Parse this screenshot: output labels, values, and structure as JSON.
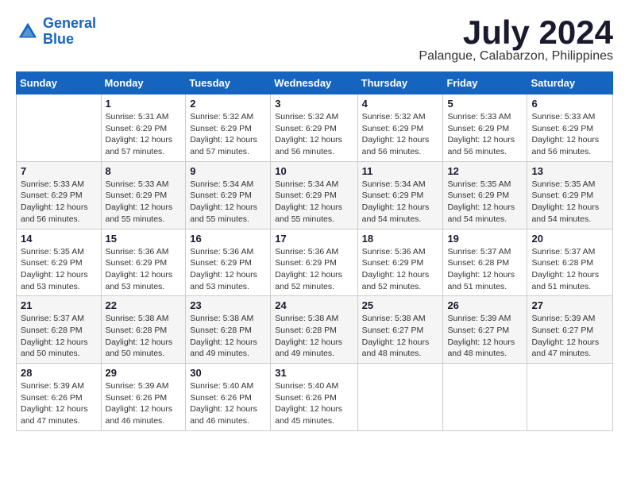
{
  "header": {
    "logo_line1": "General",
    "logo_line2": "Blue",
    "month_year": "July 2024",
    "location": "Palangue, Calabarzon, Philippines"
  },
  "weekdays": [
    "Sunday",
    "Monday",
    "Tuesday",
    "Wednesday",
    "Thursday",
    "Friday",
    "Saturday"
  ],
  "weeks": [
    [
      {
        "day": "",
        "info": ""
      },
      {
        "day": "1",
        "info": "Sunrise: 5:31 AM\nSunset: 6:29 PM\nDaylight: 12 hours\nand 57 minutes."
      },
      {
        "day": "2",
        "info": "Sunrise: 5:32 AM\nSunset: 6:29 PM\nDaylight: 12 hours\nand 57 minutes."
      },
      {
        "day": "3",
        "info": "Sunrise: 5:32 AM\nSunset: 6:29 PM\nDaylight: 12 hours\nand 56 minutes."
      },
      {
        "day": "4",
        "info": "Sunrise: 5:32 AM\nSunset: 6:29 PM\nDaylight: 12 hours\nand 56 minutes."
      },
      {
        "day": "5",
        "info": "Sunrise: 5:33 AM\nSunset: 6:29 PM\nDaylight: 12 hours\nand 56 minutes."
      },
      {
        "day": "6",
        "info": "Sunrise: 5:33 AM\nSunset: 6:29 PM\nDaylight: 12 hours\nand 56 minutes."
      }
    ],
    [
      {
        "day": "7",
        "info": "Sunrise: 5:33 AM\nSunset: 6:29 PM\nDaylight: 12 hours\nand 56 minutes."
      },
      {
        "day": "8",
        "info": "Sunrise: 5:33 AM\nSunset: 6:29 PM\nDaylight: 12 hours\nand 55 minutes."
      },
      {
        "day": "9",
        "info": "Sunrise: 5:34 AM\nSunset: 6:29 PM\nDaylight: 12 hours\nand 55 minutes."
      },
      {
        "day": "10",
        "info": "Sunrise: 5:34 AM\nSunset: 6:29 PM\nDaylight: 12 hours\nand 55 minutes."
      },
      {
        "day": "11",
        "info": "Sunrise: 5:34 AM\nSunset: 6:29 PM\nDaylight: 12 hours\nand 54 minutes."
      },
      {
        "day": "12",
        "info": "Sunrise: 5:35 AM\nSunset: 6:29 PM\nDaylight: 12 hours\nand 54 minutes."
      },
      {
        "day": "13",
        "info": "Sunrise: 5:35 AM\nSunset: 6:29 PM\nDaylight: 12 hours\nand 54 minutes."
      }
    ],
    [
      {
        "day": "14",
        "info": "Sunrise: 5:35 AM\nSunset: 6:29 PM\nDaylight: 12 hours\nand 53 minutes."
      },
      {
        "day": "15",
        "info": "Sunrise: 5:36 AM\nSunset: 6:29 PM\nDaylight: 12 hours\nand 53 minutes."
      },
      {
        "day": "16",
        "info": "Sunrise: 5:36 AM\nSunset: 6:29 PM\nDaylight: 12 hours\nand 53 minutes."
      },
      {
        "day": "17",
        "info": "Sunrise: 5:36 AM\nSunset: 6:29 PM\nDaylight: 12 hours\nand 52 minutes."
      },
      {
        "day": "18",
        "info": "Sunrise: 5:36 AM\nSunset: 6:29 PM\nDaylight: 12 hours\nand 52 minutes."
      },
      {
        "day": "19",
        "info": "Sunrise: 5:37 AM\nSunset: 6:28 PM\nDaylight: 12 hours\nand 51 minutes."
      },
      {
        "day": "20",
        "info": "Sunrise: 5:37 AM\nSunset: 6:28 PM\nDaylight: 12 hours\nand 51 minutes."
      }
    ],
    [
      {
        "day": "21",
        "info": "Sunrise: 5:37 AM\nSunset: 6:28 PM\nDaylight: 12 hours\nand 50 minutes."
      },
      {
        "day": "22",
        "info": "Sunrise: 5:38 AM\nSunset: 6:28 PM\nDaylight: 12 hours\nand 50 minutes."
      },
      {
        "day": "23",
        "info": "Sunrise: 5:38 AM\nSunset: 6:28 PM\nDaylight: 12 hours\nand 49 minutes."
      },
      {
        "day": "24",
        "info": "Sunrise: 5:38 AM\nSunset: 6:28 PM\nDaylight: 12 hours\nand 49 minutes."
      },
      {
        "day": "25",
        "info": "Sunrise: 5:38 AM\nSunset: 6:27 PM\nDaylight: 12 hours\nand 48 minutes."
      },
      {
        "day": "26",
        "info": "Sunrise: 5:39 AM\nSunset: 6:27 PM\nDaylight: 12 hours\nand 48 minutes."
      },
      {
        "day": "27",
        "info": "Sunrise: 5:39 AM\nSunset: 6:27 PM\nDaylight: 12 hours\nand 47 minutes."
      }
    ],
    [
      {
        "day": "28",
        "info": "Sunrise: 5:39 AM\nSunset: 6:26 PM\nDaylight: 12 hours\nand 47 minutes."
      },
      {
        "day": "29",
        "info": "Sunrise: 5:39 AM\nSunset: 6:26 PM\nDaylight: 12 hours\nand 46 minutes."
      },
      {
        "day": "30",
        "info": "Sunrise: 5:40 AM\nSunset: 6:26 PM\nDaylight: 12 hours\nand 46 minutes."
      },
      {
        "day": "31",
        "info": "Sunrise: 5:40 AM\nSunset: 6:26 PM\nDaylight: 12 hours\nand 45 minutes."
      },
      {
        "day": "",
        "info": ""
      },
      {
        "day": "",
        "info": ""
      },
      {
        "day": "",
        "info": ""
      }
    ]
  ]
}
